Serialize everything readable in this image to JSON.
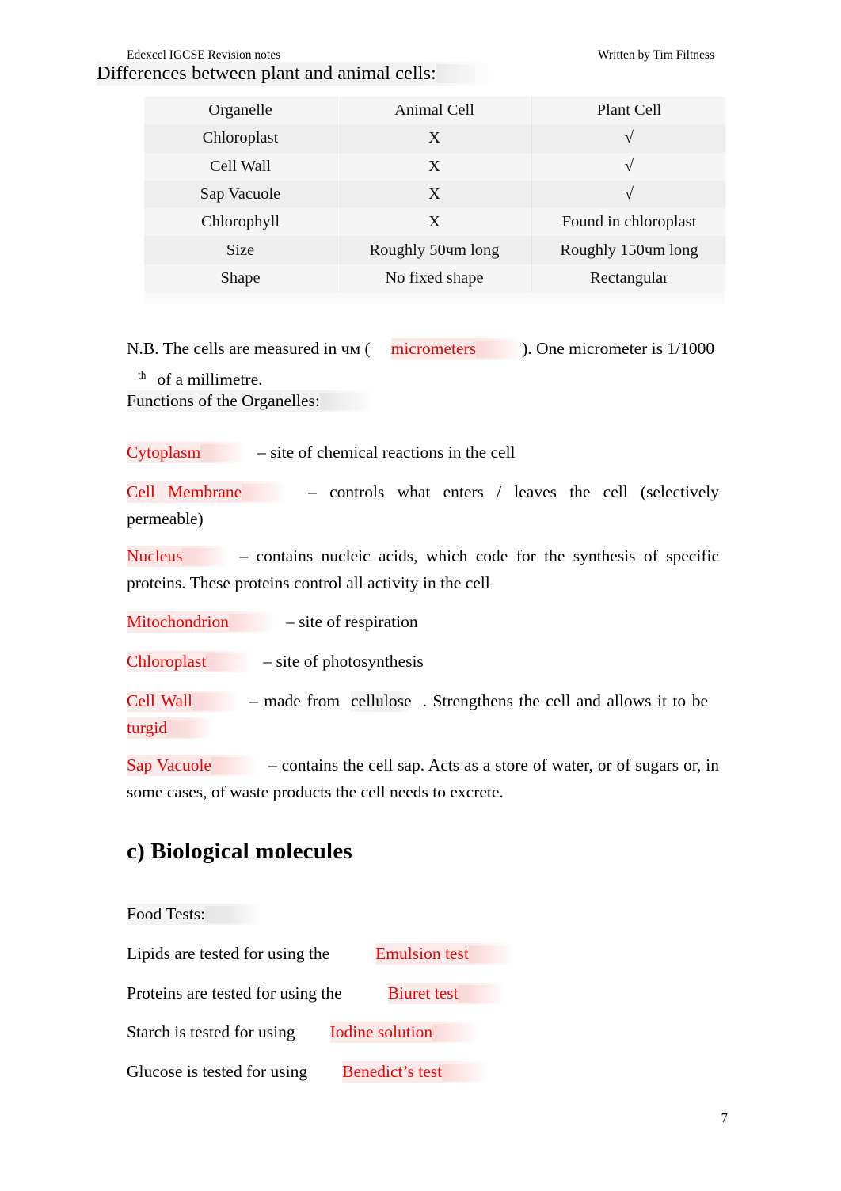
{
  "header": {
    "left": "Edexcel IGCSE Revision notes",
    "right": "Written by Tim Filtness"
  },
  "subtitle": "Differences between plant and animal cells:",
  "table": {
    "columns": [
      "Organelle",
      "Animal Cell",
      "Plant Cell"
    ],
    "rows": [
      {
        "organelle": "Chloroplast",
        "animal": "X",
        "plant": "√"
      },
      {
        "organelle": "Cell Wall",
        "animal": "X",
        "plant": "√"
      },
      {
        "organelle": "Sap Vacuole",
        "animal": "X",
        "plant": "√"
      },
      {
        "organelle": "Chlorophyll",
        "animal": "X",
        "plant": "Found in chloroplast"
      },
      {
        "organelle": "Size",
        "animal": "Roughly 50чm long",
        "plant": "Roughly 150чm long"
      },
      {
        "organelle": "Shape",
        "animal": "No fixed shape",
        "plant": "Rectangular"
      }
    ]
  },
  "nb": {
    "part1": "N.B. The cells are measured in чм (",
    "answer": "micrometers",
    "part2": "). One micrometer is 1/1000",
    "sup": "th",
    "part3": "of a millimetre."
  },
  "functions_heading": "Functions of the Organelles:",
  "organelles": [
    {
      "term": "Cytoplasm",
      "term_color": "red",
      "definition": "– site of chemical reactions in the cell"
    },
    {
      "term": "Cell Membrane",
      "term_color": "red",
      "definition": "– controls what enters / leaves the cell (selectively permeable)"
    },
    {
      "term": "Nucleus",
      "term_color": "red",
      "definition": "– contains nucleic acids, which code for the synthesis of specific proteins. These proteins control all activity in the cell"
    },
    {
      "term": "Mitochondrion",
      "term_color": "red",
      "definition": "– site of respiration"
    },
    {
      "term": "Chloroplast",
      "term_color": "red",
      "definition": "– site of photosynthesis"
    }
  ],
  "cell_wall": {
    "term": "Cell Wall",
    "part1": "– made from",
    "answer1": "cellulose",
    "part2": ". Strengthens the cell and allows it to be",
    "answer2": "turgid"
  },
  "sap_vacuole": {
    "term": "Sap Vacuole",
    "definition": "– contains the cell sap. Acts as a store of water, or of sugars or, in some cases, of waste products the cell needs to excrete."
  },
  "section_heading": "c) Biological molecules",
  "food_tests_heading": "Food Tests:",
  "food_tests": [
    {
      "prompt": "Lipids are tested for using the",
      "answer": "Emulsion test"
    },
    {
      "prompt": "Proteins are tested for using the",
      "answer": "Biuret test"
    },
    {
      "prompt": "Starch is tested for using",
      "answer": "Iodine solution"
    },
    {
      "prompt": "Glucose is tested for using",
      "answer": "Benedict’s test"
    }
  ],
  "page_number": "7",
  "colors": {
    "answer_red": "#ee0000",
    "text_black": "#000000",
    "table_band": "#f2f2f2"
  }
}
